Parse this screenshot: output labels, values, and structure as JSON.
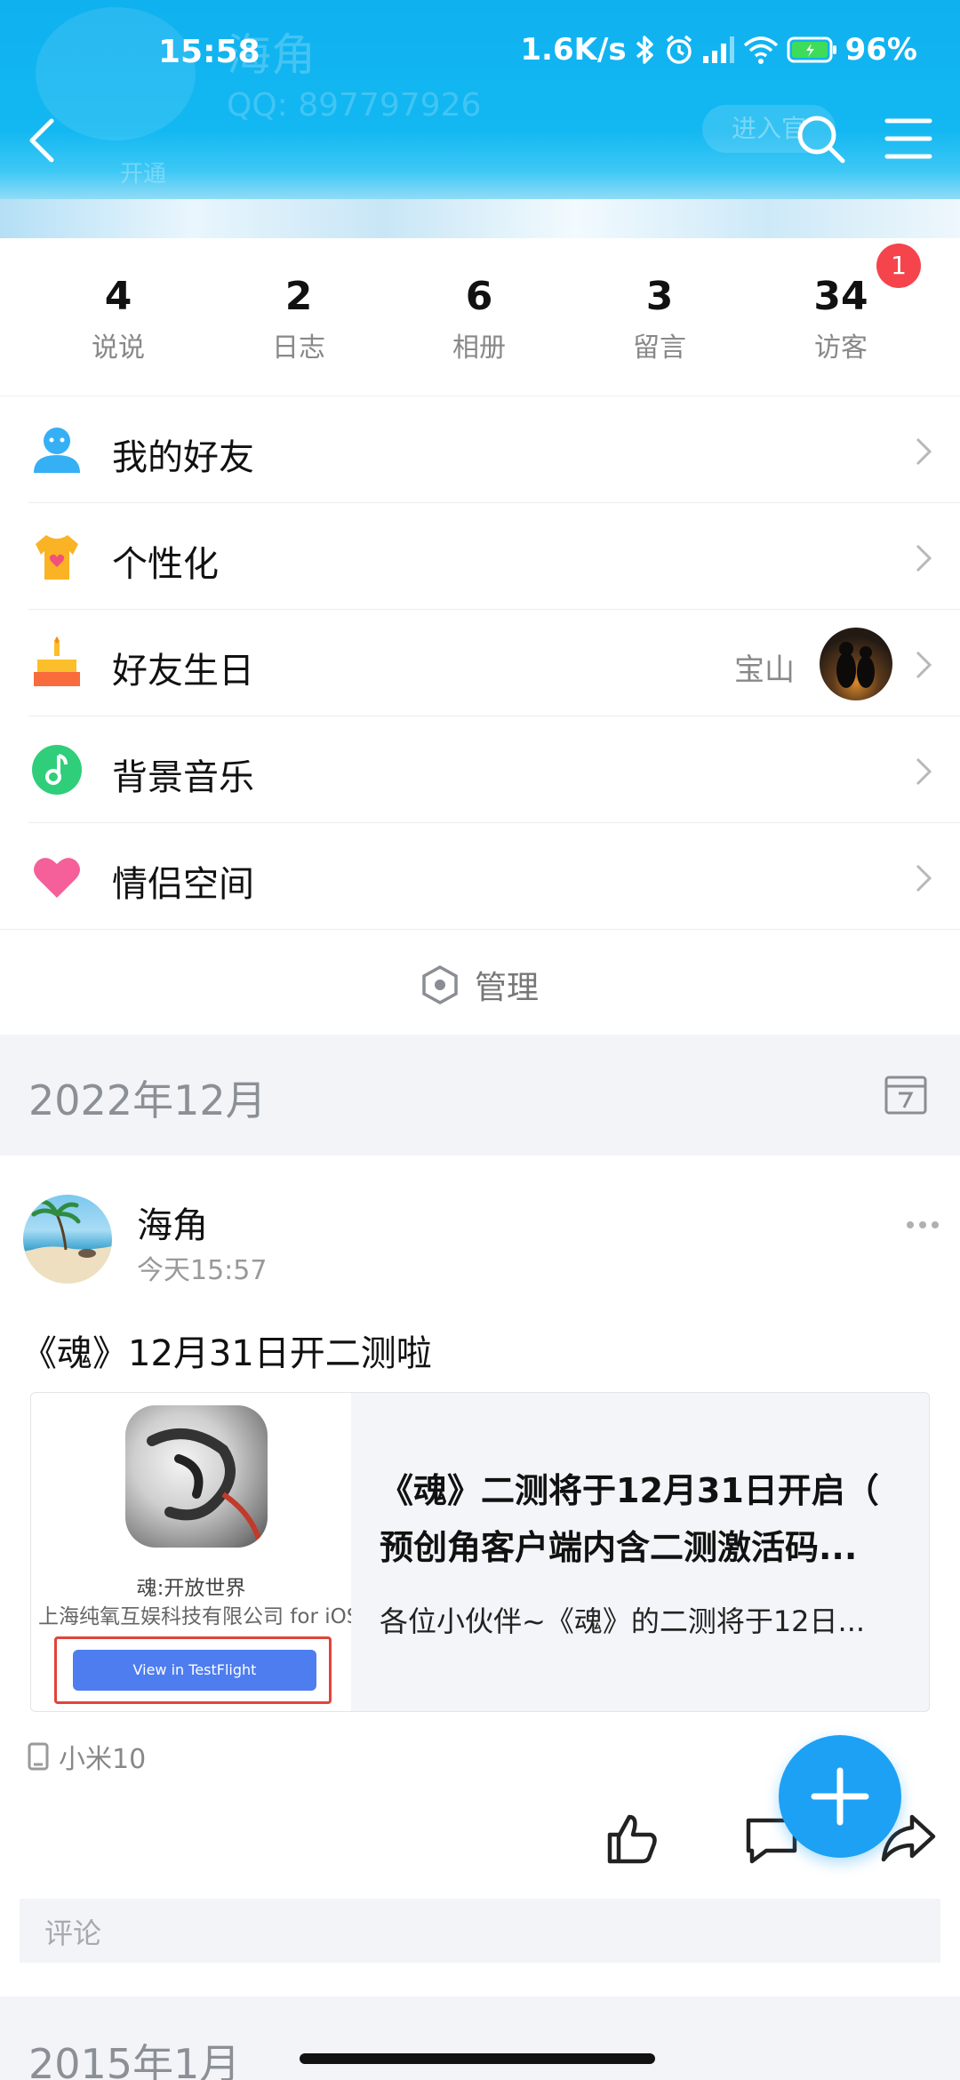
{
  "status_bar": {
    "time": "15:58",
    "speed": "1.6K/s",
    "battery": "96%"
  },
  "header": {
    "back_icon": "chevron-left-icon",
    "search_icon": "search-icon",
    "menu_icon": "hamburger-menu-icon",
    "ghost_name": "海角",
    "ghost_qq": "QQ: 897797926",
    "ghost_open": "开通",
    "ghost_enter": "进入官"
  },
  "stats": [
    {
      "num": "4",
      "label": "说说"
    },
    {
      "num": "2",
      "label": "日志"
    },
    {
      "num": "6",
      "label": "相册"
    },
    {
      "num": "3",
      "label": "留言"
    },
    {
      "num": "34",
      "label": "访客"
    }
  ],
  "visitor_badge": "1",
  "menu": {
    "friends": "我的好友",
    "personalize": "个性化",
    "birthday": "好友生日",
    "birthday_name": "宝山",
    "music": "背景音乐",
    "couple": "情侣空间",
    "manage": "管理"
  },
  "section_date": "2022年12月",
  "post": {
    "author": "海角",
    "time": "今天15:57",
    "text": "《魂》12月31日开二测啦",
    "card": {
      "app_name": "魂:开放世界",
      "app_company": "上海纯氧互娱科技有限公司 for iOS",
      "button": "View in TestFlight",
      "title_line1": "《魂》二测将于12月31日开启（",
      "title_line2": "预创角客户端内含二测激活码...",
      "desc": "各位小伙伴~《魂》的二测将于12日..."
    },
    "device": "小米10",
    "comment_placeholder": "评论"
  },
  "next_section_date": "2015年1月",
  "colors": {
    "header_blue": "#13b8f2",
    "fab_blue": "#1da1f5",
    "badge_red": "#f5444c"
  }
}
